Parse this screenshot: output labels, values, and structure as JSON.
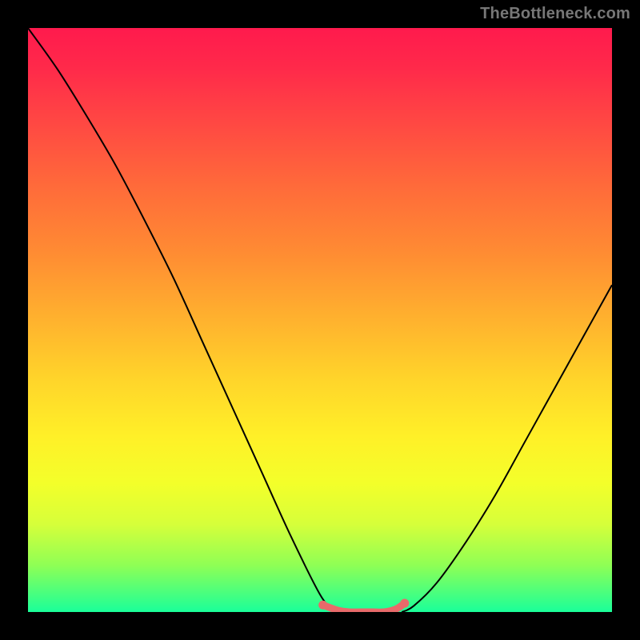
{
  "watermark": "TheBottleneck.com",
  "colors": {
    "frame": "#000000",
    "gradient_top": "#ff1a4d",
    "gradient_bottom": "#1aff9a",
    "curve": "#000000",
    "worm": "#e86a6a"
  },
  "chart_data": {
    "type": "line",
    "title": "",
    "xlabel": "",
    "ylabel": "",
    "xlim": [
      0,
      100
    ],
    "ylim": [
      0,
      100
    ],
    "grid": false,
    "legend": false,
    "series": [
      {
        "name": "left-curve",
        "x": [
          0,
          5,
          10,
          15,
          20,
          25,
          30,
          35,
          40,
          45,
          50,
          52.5
        ],
        "y": [
          100,
          93,
          85,
          76.5,
          67,
          57,
          46,
          35,
          24,
          13,
          3,
          0
        ]
      },
      {
        "name": "right-curve",
        "x": [
          64,
          66,
          70,
          75,
          80,
          85,
          90,
          95,
          100
        ],
        "y": [
          0,
          1,
          5,
          12,
          20,
          29,
          38,
          47,
          56
        ]
      },
      {
        "name": "flat-region",
        "x": [
          50.5,
          53,
          55,
          57,
          59,
          61,
          63,
          64.5
        ],
        "y": [
          1.2,
          0.3,
          0,
          0,
          0,
          0,
          0.5,
          1.5
        ]
      }
    ],
    "annotations": [
      {
        "text": "TheBottleneck.com",
        "position": "top-right"
      }
    ]
  }
}
